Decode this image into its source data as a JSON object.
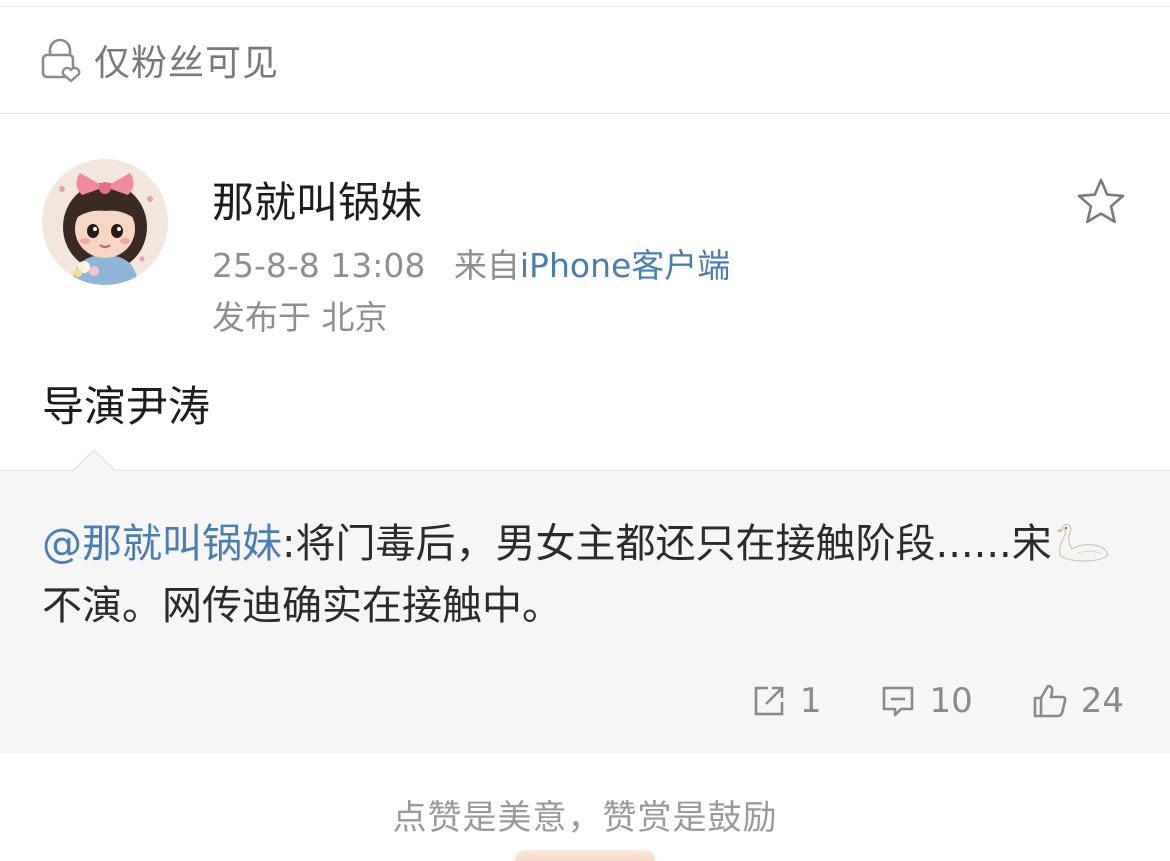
{
  "visibility": {
    "icon": "lock-heart-icon",
    "text": "仅粉丝可见"
  },
  "post": {
    "author": "那就叫锅妹",
    "timestamp": "25-8-8 13:08",
    "source_prefix": "来自",
    "source": "iPhone客户端",
    "location": "发布于 北京",
    "text": "导演尹涛",
    "favorite_icon": "star-outline-icon"
  },
  "repost": {
    "mention": "@那就叫锅妹",
    "text_part1": ":将门毒后，男女主都还只在接触阶段......宋",
    "swan_icon": "swan-icon",
    "text_part2": "不演。网传迪确实在接触中。",
    "actions": {
      "share_count": "1",
      "comment_count": "10",
      "like_count": "24"
    }
  },
  "footer": {
    "hint": "点赞是美意，赞赏是鼓励"
  },
  "colors": {
    "link_blue": "#4a7db3",
    "muted_gray": "#8f8f8f",
    "repost_bg": "#f6f6f6"
  }
}
